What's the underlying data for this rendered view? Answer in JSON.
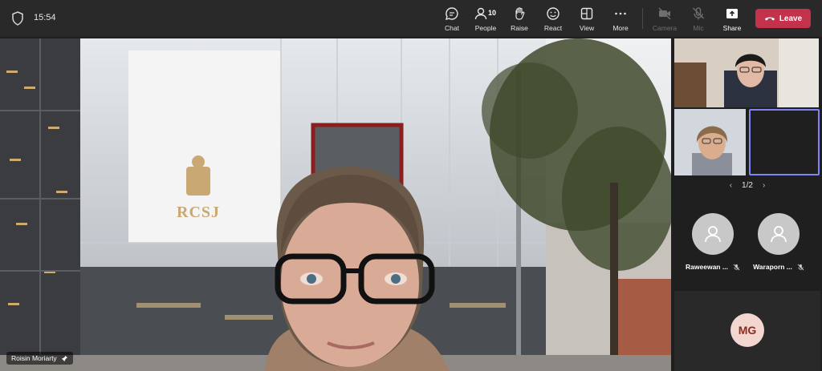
{
  "topbar": {
    "time": "15:54",
    "chat_label": "Chat",
    "people_label": "People",
    "people_count": "10",
    "raise_label": "Raise",
    "react_label": "React",
    "view_label": "View",
    "more_label": "More",
    "camera_label": "Camera",
    "mic_label": "Mic",
    "share_label": "Share",
    "leave_label": "Leave"
  },
  "stage": {
    "speaker_name": "Roisin Moriarty",
    "building_sign": "RCSJ"
  },
  "gallery": {
    "page_indicator": "1/2",
    "participants": [
      {
        "name": "Raweewan ..."
      },
      {
        "name": "Waraporn ..."
      }
    ],
    "initials_tile": "MG"
  },
  "colors": {
    "leave_red": "#c4314b",
    "active_border": "#7f85f5",
    "bar_bg": "#292929"
  }
}
